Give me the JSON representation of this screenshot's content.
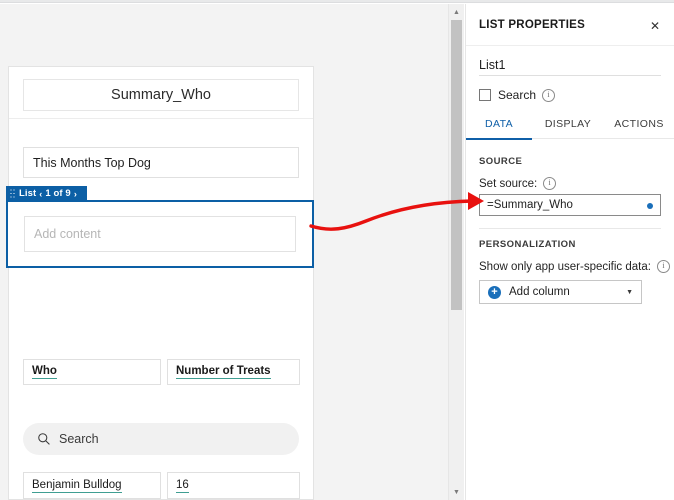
{
  "canvas": {
    "title": "Summary_Who",
    "subtitle": "This Months Top Dog",
    "list_badge": {
      "label": "List",
      "prev_icon": "chevron-left-icon",
      "pager": "1 of 9",
      "next_icon": "chevron-right-icon"
    },
    "add_content_placeholder": "Add content",
    "table": {
      "headers": [
        "Who",
        "Number of Treats"
      ],
      "rows": [
        [
          "Benjamin Bulldog",
          "16"
        ]
      ]
    },
    "search": {
      "placeholder": "Search",
      "icon": "search-icon"
    },
    "scrollbar": {
      "up_icon": "caret-up-icon",
      "down_icon": "caret-down-icon"
    }
  },
  "properties": {
    "panel_title": "LIST PROPERTIES",
    "close_icon": "close-icon",
    "control_name": "List1",
    "search_checkbox": {
      "label": "Search",
      "checked": false,
      "info_icon": "info-icon"
    },
    "tabs": [
      {
        "label": "DATA",
        "active": true
      },
      {
        "label": "DISPLAY",
        "active": false
      },
      {
        "label": "ACTIONS",
        "active": false
      }
    ],
    "source_section": {
      "heading": "SOURCE",
      "field_label": "Set source:",
      "info_icon": "info-icon",
      "value": "=Summary_Who",
      "status_dot": "filled-dot-icon"
    },
    "personalization_section": {
      "heading": "PERSONALIZATION",
      "field_label": "Show only app user-specific data:",
      "info_icon": "info-icon",
      "add_column_label": "Add column",
      "add_column_icon": "plus-circle-icon",
      "caret_icon": "caret-down-icon"
    }
  },
  "annotation": {
    "type": "arrow",
    "color": "#e8110f",
    "description": "arrow-pointing-to-set-source-field"
  },
  "colors": {
    "selection_blue": "#0c5fa5",
    "accent_blue": "#0f5fa8",
    "underline_teal": "#3f9e92",
    "annotation_red": "#e8110f",
    "canvas_bg": "#f3f3f3"
  }
}
